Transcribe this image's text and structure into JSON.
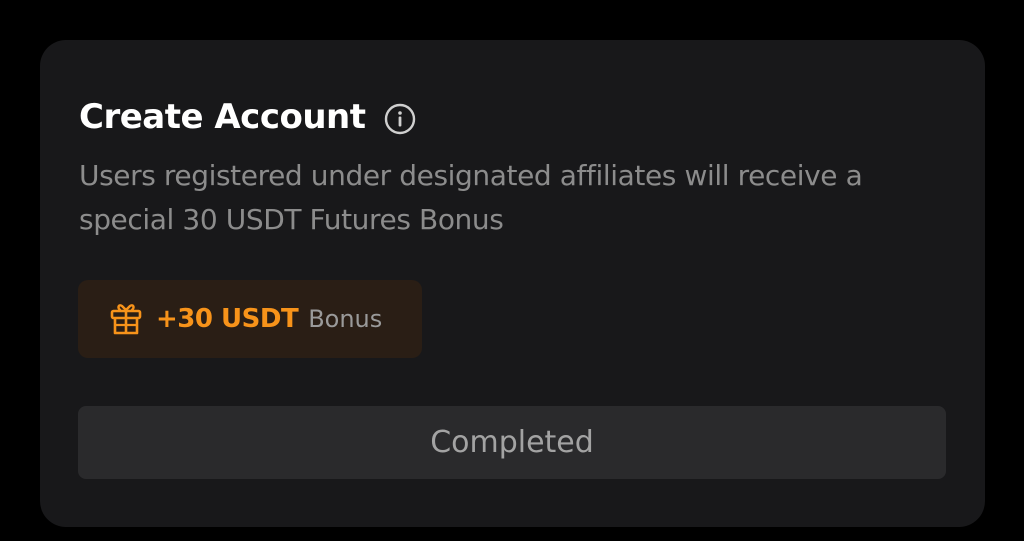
{
  "task": {
    "title": "Create Account",
    "info_icon": "info-circle-icon",
    "description": "Users registered under designated affiliates will receive a special 30 USDT Futures Bonus",
    "bonus": {
      "icon": "gift-icon",
      "amount": "+30 USDT",
      "label": "Bonus"
    },
    "action_label": "Completed"
  },
  "colors": {
    "page_bg": "#000000",
    "card_bg": "#18181a",
    "title": "#ffffff",
    "description": "#8c8c8c",
    "accent": "#f7931a",
    "chip_bg": "#2a1e15",
    "button_bg": "#2a2a2c",
    "button_text": "#a3a3a3"
  }
}
